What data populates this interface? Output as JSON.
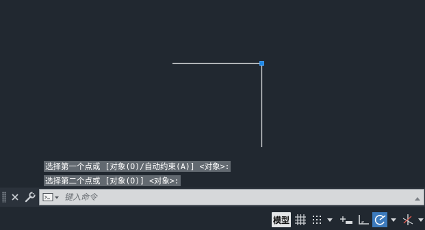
{
  "command_history": [
    "选择第一个点或 [对象(O)/自动约束(A)] <对象>:",
    "选择第二个点或 [对象(O)] <对象>:"
  ],
  "command_line": {
    "placeholder": "键入命令",
    "value": "",
    "icons": {
      "close": "close-icon",
      "customize": "wrench-icon",
      "prompt": "command-prompt-icon",
      "history": "triangle-up-icon"
    }
  },
  "status_bar": {
    "model_label": "模型",
    "icons": [
      "grid-icon",
      "snap-icon",
      "infer-constraints-icon",
      "ortho-icon",
      "polar-tracking-icon",
      "isometric-drafting-icon"
    ]
  },
  "colors": {
    "background": "#212830",
    "line": "#d8dadc",
    "grip": "#1e88e5",
    "active_toggle": "#3d7bbd"
  }
}
